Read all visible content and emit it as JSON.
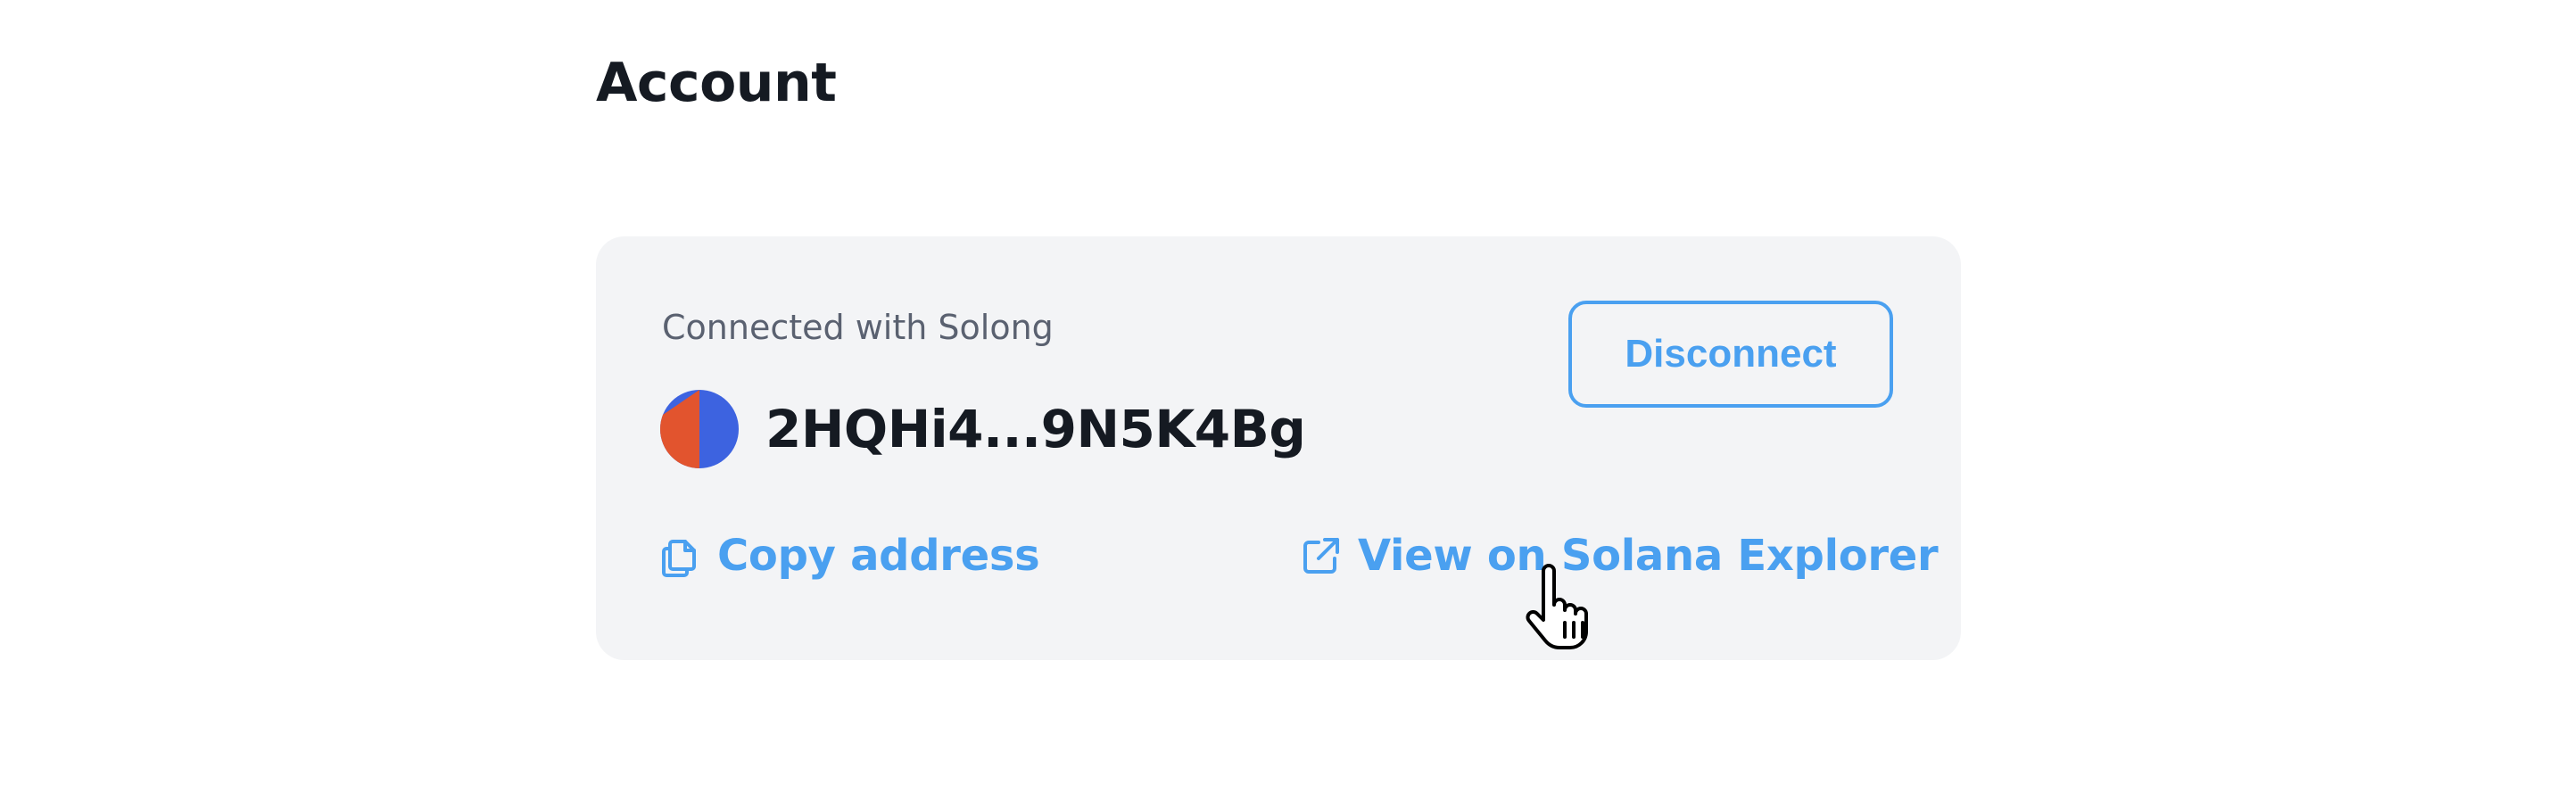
{
  "page": {
    "title": "Account"
  },
  "account_card": {
    "connected_label": "Connected with Solong",
    "address": "2HQHi4...9N5K4Bg",
    "disconnect_label": "Disconnect",
    "copy_label": "Copy address",
    "explorer_label": "View on Solana Explorer"
  },
  "icons": {
    "copy": "copy-icon",
    "external_link": "external-link-icon",
    "avatar": "wallet-avatar",
    "cursor": "hand-pointer-cursor"
  },
  "colors": {
    "accent": "#4aa0f0",
    "card_background": "#f3f4f6",
    "text_dark": "#151a22",
    "text_muted": "#5a6170",
    "avatar_blue": "#3d63e0",
    "avatar_orange": "#e2542e"
  }
}
